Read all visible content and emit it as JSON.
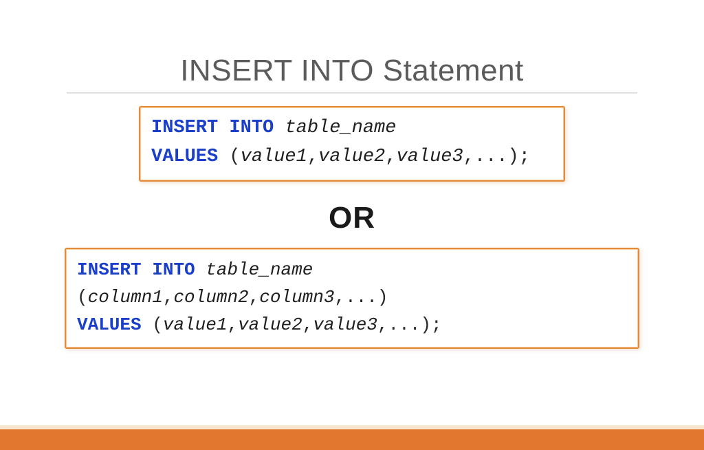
{
  "title": "INSERT INTO Statement",
  "or_label": "OR",
  "code1": {
    "k_insert": "INSERT",
    "k_into": "INTO",
    "tbl": "table_name",
    "k_values": "VALUES",
    "open": "(",
    "v1": "value1",
    "c1": ",",
    "v2": "value2",
    "c2": ",",
    "v3": "value3",
    "c3": ",",
    "dots": "...",
    "close": ");"
  },
  "code2": {
    "k_insert": "INSERT",
    "k_into": "INTO",
    "tbl": "table_name",
    "open_cols": "(",
    "col1": "column1",
    "cc1": ",",
    "col2": "column2",
    "cc2": ",",
    "col3": "column3",
    "cc3": ",",
    "col_dots": "...",
    "close_cols": ")",
    "k_values": "VALUES",
    "open": "(",
    "v1": "value1",
    "c1": ",",
    "v2": "value2",
    "c2": ",",
    "v3": "value3",
    "c3": ",",
    "dots": "...",
    "close": ");"
  }
}
